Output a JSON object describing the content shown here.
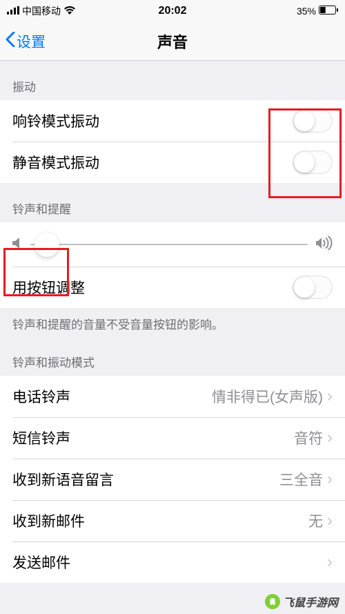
{
  "statusbar": {
    "signal_bars": 4,
    "carrier": "中国移动",
    "wifi": true,
    "time": "20:02",
    "battery_pct": "35%"
  },
  "nav": {
    "back_label": "设置",
    "title": "声音"
  },
  "vibration": {
    "header": "振动",
    "ring_label": "响铃模式振动",
    "ring_on": false,
    "silent_label": "静音模式振动",
    "silent_on": false
  },
  "ringer": {
    "header": "铃声和提醒",
    "slider_value": 0.06,
    "buttons_label": "用按钮调整",
    "buttons_on": false,
    "footer": "铃声和提醒的音量不受音量按钮的影响。"
  },
  "patterns": {
    "header": "铃声和振动模式",
    "items": [
      {
        "label": "电话铃声",
        "value": "情非得已(女声版)"
      },
      {
        "label": "短信铃声",
        "value": "音符"
      },
      {
        "label": "收到新语音留言",
        "value": "三全音"
      },
      {
        "label": "收到新邮件",
        "value": "无"
      },
      {
        "label": "发送邮件",
        "value": ""
      }
    ]
  },
  "annotations": {
    "switch_box": true,
    "slider_box": true
  },
  "watermark": {
    "text": "飞鼠手游网"
  }
}
